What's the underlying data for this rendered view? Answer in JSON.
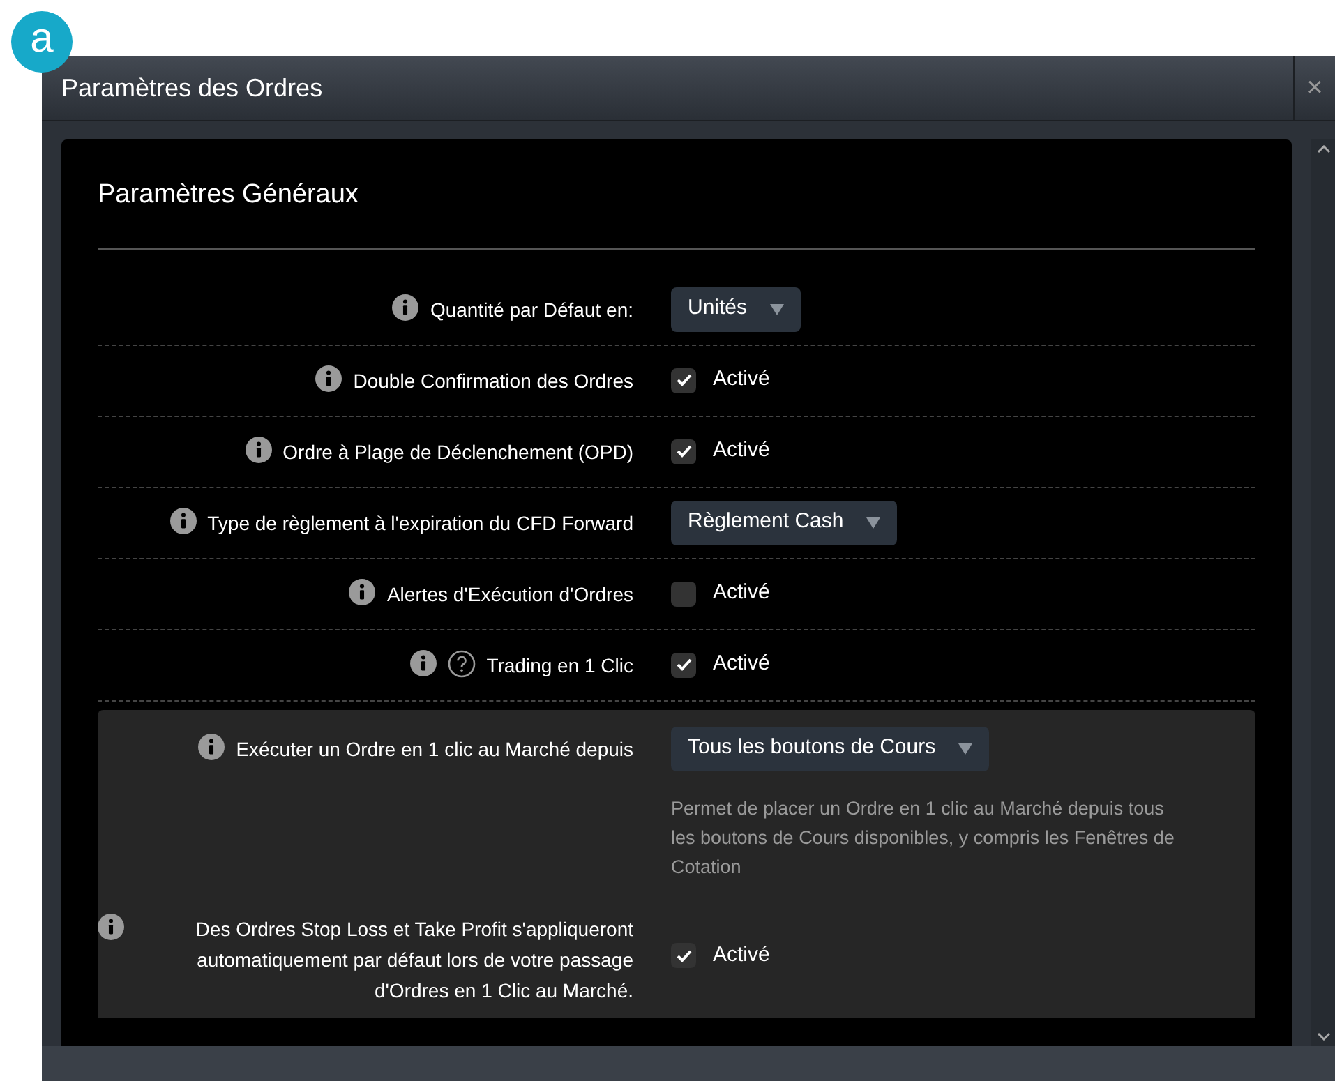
{
  "badge": "a",
  "window": {
    "title": "Paramètres des Ordres",
    "close": "×"
  },
  "section": {
    "title": "Paramètres Généraux"
  },
  "rows": [
    {
      "kind": "select",
      "label": "Quantité par Défaut en:",
      "value": "Unités"
    },
    {
      "kind": "checkbox",
      "label": "Double Confirmation des Ordres",
      "checked": true,
      "option": "Activé"
    },
    {
      "kind": "checkbox",
      "label": "Ordre à Plage de Déclenchement (OPD)",
      "checked": true,
      "option": "Activé"
    },
    {
      "kind": "select",
      "label": "Type de règlement à l'expiration du CFD Forward",
      "value": "Règlement Cash"
    },
    {
      "kind": "checkbox",
      "label": "Alertes d'Exécution d'Ordres",
      "checked": false,
      "option": "Activé"
    },
    {
      "kind": "checkbox",
      "label": "Trading en 1 Clic",
      "checked": true,
      "option": "Activé",
      "help": true
    }
  ],
  "sub_rows": [
    {
      "kind": "select",
      "label": "Exécuter un Ordre en 1 clic au Marché depuis",
      "value": "Tous les boutons de Cours",
      "description": "Permet de placer un Ordre en 1 clic au Marché depuis tous les boutons de Cours disponibles, y compris les Fenêtres de Cotation"
    },
    {
      "kind": "checkbox",
      "label": "Des Ordres Stop Loss et Take Profit s'appliqueront automatiquement par défaut lors de votre passage d'Ordres en 1 Clic au Marché.",
      "checked": true,
      "option": "Activé"
    }
  ]
}
